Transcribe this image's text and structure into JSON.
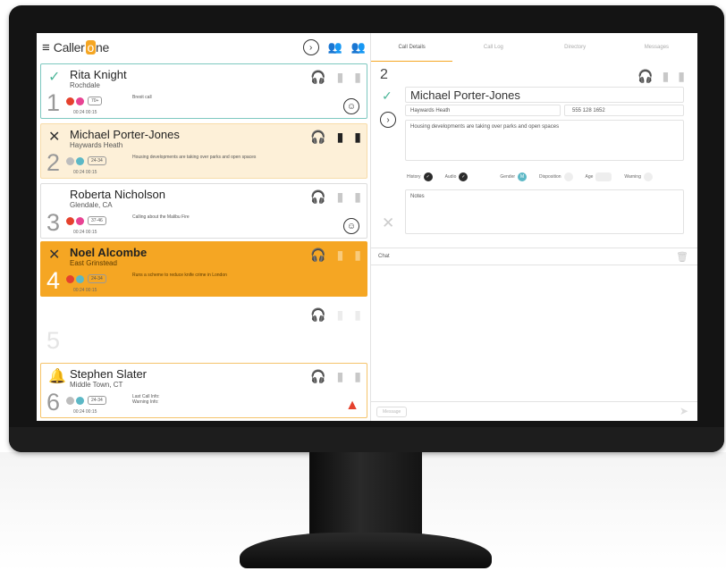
{
  "app": {
    "logo_prefix": "Caller",
    "logo_suffix": "ne"
  },
  "calls": [
    {
      "number": "1",
      "name": "Rita Knight",
      "location": "Rochdale",
      "badge": "70+",
      "desc": "Brexit call",
      "time": "00:24 00:15",
      "status": "check",
      "end": "smile",
      "dots": [
        "#e5412d",
        "#e84393"
      ]
    },
    {
      "number": "2",
      "name": "Michael Porter-Jones",
      "location": "Haywards Heath",
      "badge": "24-34",
      "desc": "Housing developments are taking over parks and open spaces",
      "time": "00:24 00:15",
      "status": "x",
      "end": "",
      "dots": [
        "#bdbdbd",
        "#5cb8c6"
      ]
    },
    {
      "number": "3",
      "name": "Roberta Nicholson",
      "location": "Glendale, CA",
      "badge": "37-46",
      "desc": "Calling about the Malibu Fire",
      "time": "00:24 00:15",
      "status": "",
      "end": "smile",
      "dots": [
        "#e5412d",
        "#e84393"
      ]
    },
    {
      "number": "4",
      "name": "Noel Alcombe",
      "location": "East Grinstead",
      "badge": "24-34",
      "desc": "Runs a scheme to reduce knife crime in London",
      "time": "00:24 00:15",
      "status": "x",
      "end": "",
      "dots": [
        "#e5412d",
        "#5cb8c6"
      ]
    },
    {
      "number": "5",
      "name": "",
      "location": "",
      "badge": "",
      "desc": "",
      "time": "",
      "status": "",
      "end": "",
      "dots": []
    },
    {
      "number": "6",
      "name": "Stephen Slater",
      "location": "Middle Town, CT",
      "badge": "24-34",
      "desc": "Last Call Info:\nWarning Info:",
      "time": "00:24 00:15",
      "status": "alert",
      "end": "warning",
      "dots": [
        "#bdbdbd",
        "#5cb8c6"
      ]
    }
  ],
  "tabs": [
    "Call Details",
    "Call Log",
    "Directory",
    "Messages"
  ],
  "detail": {
    "number": "2",
    "name": "Michael Porter-Jones",
    "location": "Haywards Heath",
    "phone": "555 128 1652",
    "description": "Housing developments are taking over parks and open spaces",
    "toggles": {
      "history": "History",
      "audio": "Audio",
      "gender": "Gender",
      "disposition": "Disposition",
      "age": "Age",
      "warning": "Warning"
    },
    "notes_placeholder": "Notes"
  },
  "chat": {
    "label": "Chat"
  },
  "message": {
    "button": "Message"
  },
  "colors": {
    "accent": "#f5a623",
    "teal": "#4fb79a",
    "alert": "#e5412d"
  }
}
